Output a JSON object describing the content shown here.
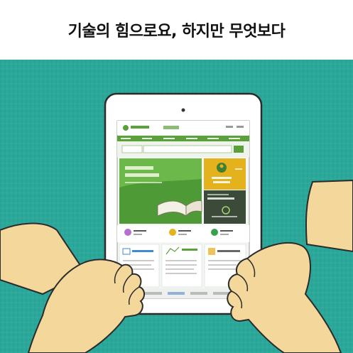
{
  "headline": "기술의 힘으로요, 하지만 무엇보다",
  "colors": {
    "background": "#2aa89a",
    "hand": "#f4d79a",
    "tablet_frame": "#ffffff",
    "site_green": "#5aa13a",
    "site_dark_green": "#2f7a3b",
    "site_yellow": "#e3b21c"
  },
  "icons": [
    "home-camera-icon",
    "person-icon",
    "pin-icon",
    "book-icon"
  ]
}
